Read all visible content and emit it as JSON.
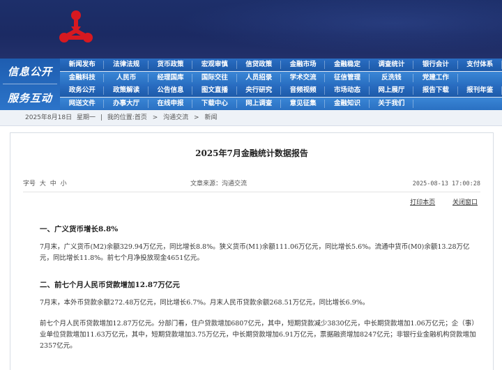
{
  "header": {
    "logo_icon": "pboc-logo-icon",
    "colors": {
      "banner": "#1d2f6a",
      "nav": "#2a6ec3",
      "logo": "#d71920"
    }
  },
  "nav": {
    "label_top": "信息公开",
    "label_bottom": "服务互动",
    "rows": [
      [
        "新闻发布",
        "法律法规",
        "货币政策",
        "宏观审慎",
        "信贷政策",
        "金融市场",
        "金融稳定",
        "调查统计",
        "银行会计",
        "支付体系"
      ],
      [
        "金融科技",
        "人民币",
        "经理国库",
        "国际交往",
        "人员招录",
        "学术交流",
        "征信管理",
        "反洗钱",
        "党建工作"
      ],
      [
        "政务公开",
        "政策解读",
        "公告信息",
        "图文直播",
        "央行研究",
        "音频视频",
        "市场动态",
        "网上展厅",
        "报告下载",
        "报刊年鉴"
      ],
      [
        "网送文件",
        "办事大厅",
        "在线申报",
        "下载中心",
        "网上调查",
        "意见征集",
        "金融知识",
        "关于我们"
      ]
    ]
  },
  "breadcrumb": {
    "date": "2025年8月18日",
    "weekday": "星期一",
    "location_label": "我的位置:",
    "home": "首页",
    "section": "沟通交流",
    "current": "新闻",
    "separator": "|",
    "arrow": ">"
  },
  "article": {
    "title": "2025年7月金融统计数据报告",
    "font_size_label": "字号",
    "size_large": "大",
    "size_medium": "中",
    "size_small": "小",
    "source": "文章来源：沟通交流",
    "time": "2025-08-13 17:00:28",
    "print": "打印本页",
    "close": "关闭窗口",
    "sections": [
      {
        "heading": "一、广义货币增长8.8%",
        "paragraphs": [
          "7月末，广义货币(M2)余额329.94万亿元，同比增长8.8%。狭义货币(M1)余额111.06万亿元，同比增长5.6%。流通中货币(M0)余额13.28万亿元，同比增长11.8%。前七个月净投放现金4651亿元。"
        ]
      },
      {
        "heading": "二、前七个月人民币贷款增加12.87万亿元",
        "paragraphs": [
          "7月末，本外币贷款余额272.48万亿元，同比增长6.7%。月末人民币贷款余额268.51万亿元，同比增长6.9%。",
          "前七个月人民币贷款增加12.87万亿元。分部门看，住户贷款增加6807亿元，其中，短期贷款减少3830亿元，中长期贷款增加1.06万亿元；企（事）业单位贷款增加11.63万亿元，其中，短期贷款增加3.75万亿元，中长期贷款增加6.91万亿元，票据融资增加8247亿元；非银行业金融机构贷款增加2357亿元。"
        ]
      }
    ]
  }
}
